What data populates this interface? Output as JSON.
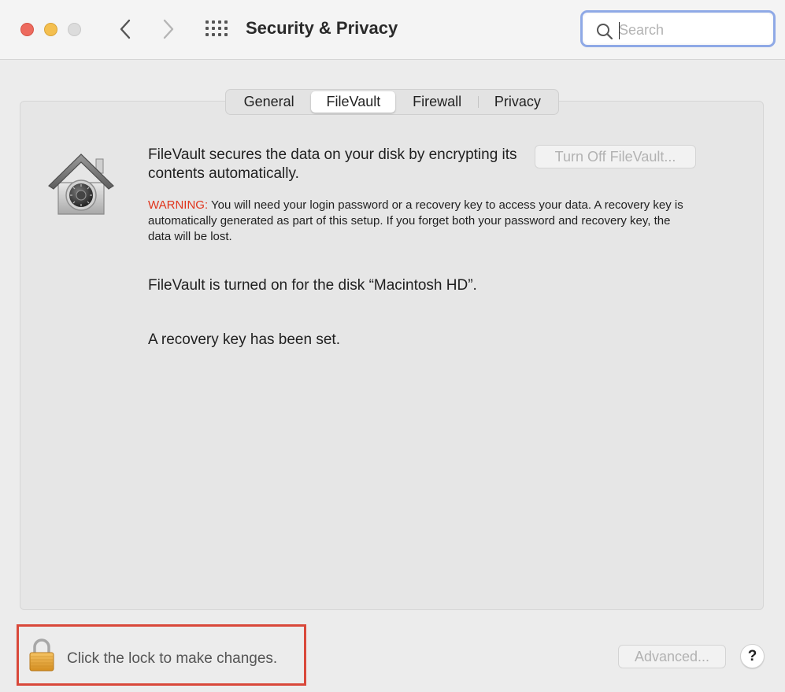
{
  "window": {
    "title": "Security & Privacy",
    "controls": [
      "close",
      "minimize",
      "zoom"
    ]
  },
  "toolbar": {
    "back_icon": "chevron-left-icon",
    "forward_icon": "chevron-right-icon",
    "grid_icon": "show-all-grid-icon"
  },
  "search": {
    "placeholder": "Search",
    "value": "",
    "icon": "search-icon",
    "focus_ring_color": "#8fa9e6"
  },
  "tabs": [
    {
      "label": "General",
      "selected": false
    },
    {
      "label": "FileVault",
      "selected": true
    },
    {
      "label": "Firewall",
      "selected": false
    },
    {
      "label": "Privacy",
      "selected": false
    }
  ],
  "filevault": {
    "icon": "filevault-house-safe-icon",
    "description": "FileVault secures the data on your disk by encrypting its contents automatically.",
    "turn_off_label": "Turn Off FileVault...",
    "warning_label": "WARNING:",
    "warning_text": " You will need your login password or a recovery key to access your data. A recovery key is automatically generated as part of this setup. If you forget both your password and recovery key, the data will be lost.",
    "warning_color": "#e0341c",
    "status_disk": "FileVault is turned on for the disk “Macintosh HD”.",
    "status_recovery": "A recovery key has been set."
  },
  "footer": {
    "lock_icon": "padlock-icon",
    "lock_text": "Click the lock to make changes.",
    "highlight_color": "#d9483a",
    "advanced_label": "Advanced...",
    "help_label": "?"
  }
}
